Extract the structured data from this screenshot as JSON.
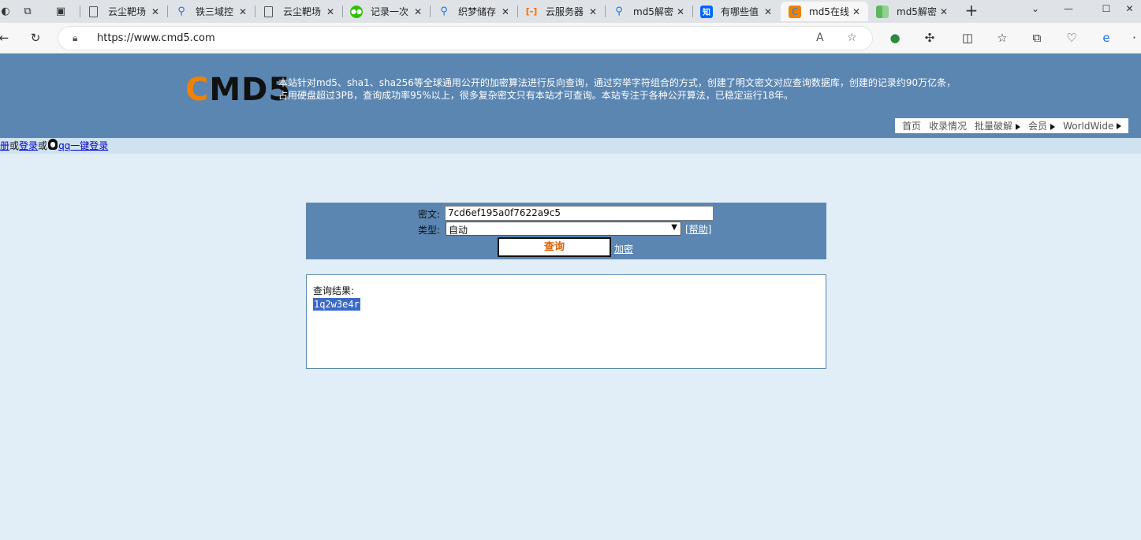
{
  "browser": {
    "tabs": [
      {
        "title": "云尘靶场",
        "favicon_color": "#ffffff",
        "icon": "page-icon"
      },
      {
        "title": "铁三域控",
        "favicon_color": "#1a73e8",
        "icon": "search-icon"
      },
      {
        "title": "云尘靶场",
        "favicon_color": "#ffffff",
        "icon": "page-icon"
      },
      {
        "title": "记录一次",
        "favicon_color": "#2dc100",
        "icon": "wechat-icon"
      },
      {
        "title": "织梦储存",
        "favicon_color": "#1a73e8",
        "icon": "search-icon"
      },
      {
        "title": "云服务器",
        "favicon_color": "#ff6a00",
        "icon": "aliyun-icon"
      },
      {
        "title": "md5解密",
        "favicon_color": "#1a73e8",
        "icon": "search-icon"
      },
      {
        "title": "有哪些值",
        "favicon_color": "#0066ff",
        "icon": "zhihu-icon",
        "badge": "知"
      },
      {
        "title": "md5在线",
        "favicon_color": "#f08200",
        "icon": "cmd5-icon",
        "active": true
      },
      {
        "title": "md5解密",
        "favicon_color": "#5cb85c",
        "icon": "grid-icon"
      }
    ],
    "url": "https://www.cmd5.com"
  },
  "site": {
    "logo_c": "C",
    "logo_rest": "MD5",
    "intro_line1": "本站针对md5、sha1、sha256等全球通用公开的加密算法进行反向查询，通过穷举字符组合的方式，创建了明文密文对应查询数据库，创建的记录约90万亿条，",
    "intro_line2": "占用硬盘超过3PB，查询成功率95%以上，很多复杂密文只有本站才可查询。本站专注于各种公开算法，已稳定运行18年。",
    "nav": {
      "home": "首页",
      "records": "收录情况",
      "batch": "批量破解",
      "member": "会员",
      "worldwide": "WorldWide"
    },
    "login": {
      "register": "册",
      "or1": "或",
      "login": "登录",
      "or2": "或",
      "qq": "qq一键登录"
    }
  },
  "query": {
    "cipher_label": "密文:",
    "cipher_value": "7cd6ef195a0f7622a9c5",
    "type_label": "类型:",
    "type_value": "自动",
    "help": "[帮助]",
    "submit": "查询",
    "encrypt": "加密"
  },
  "result": {
    "title": "查询结果:",
    "value": "1q2w3e4r"
  }
}
